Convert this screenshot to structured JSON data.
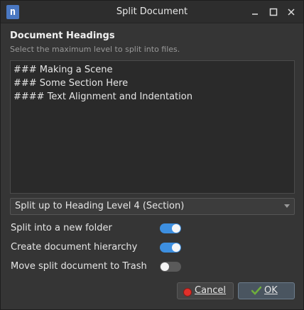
{
  "window": {
    "title": "Split Document",
    "app_icon_glyph": "n"
  },
  "headings": {
    "title": "Document Headings",
    "subtitle": "Select the maximum level to split into files.",
    "items": [
      "### Making a Scene",
      "### Some Section Here",
      "#### Text Alignment and Indentation"
    ]
  },
  "split_level": {
    "selected": "Split up to Heading Level 4 (Section)"
  },
  "options": [
    {
      "label": "Split into a new folder",
      "enabled": true
    },
    {
      "label": "Create document hierarchy",
      "enabled": true
    },
    {
      "label": "Move split document to Trash",
      "enabled": false
    }
  ],
  "buttons": {
    "cancel": "Cancel",
    "ok": "OK"
  },
  "colors": {
    "toggle_on": "#3d8fe0",
    "cancel_icon": "#e0302a",
    "ok_icon": "#6fae3c"
  }
}
